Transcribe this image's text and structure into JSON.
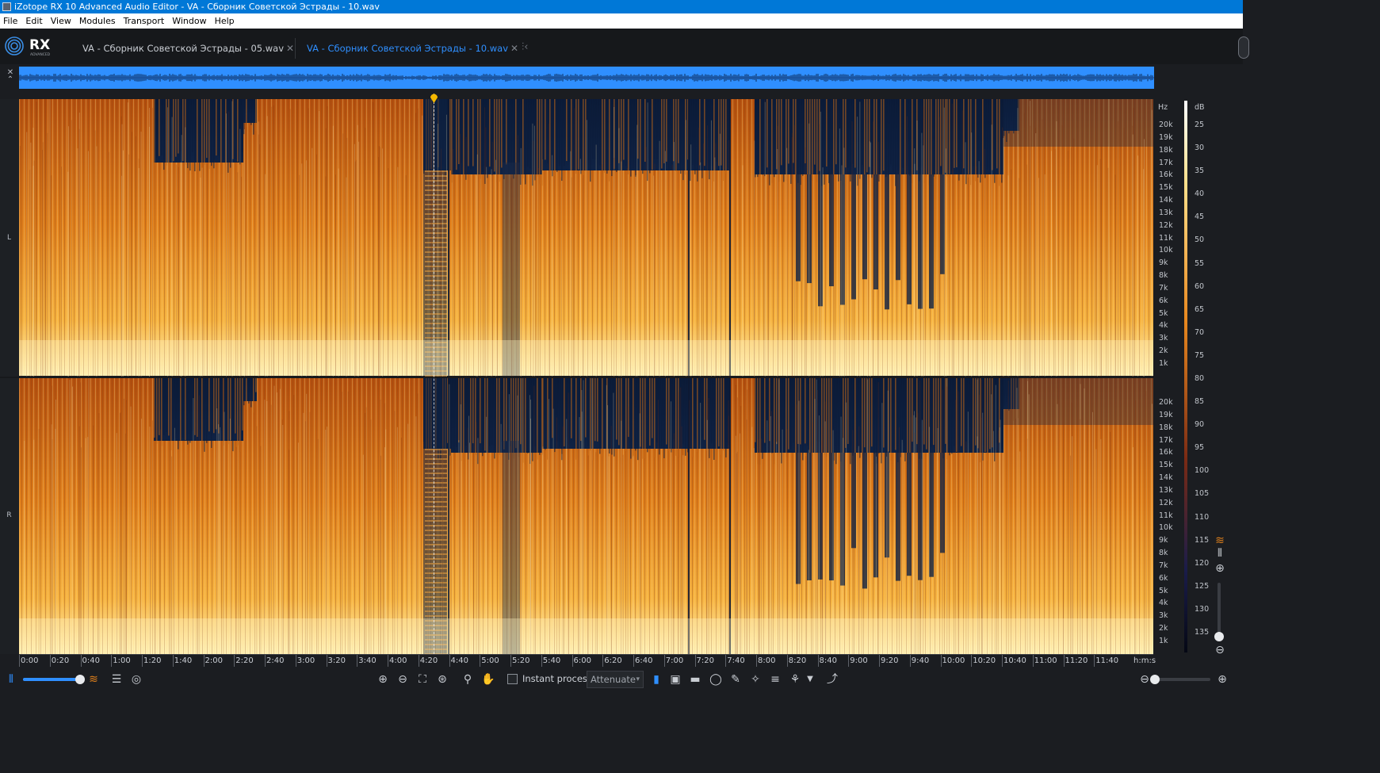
{
  "window": {
    "title": "iZotope RX 10 Advanced Audio Editor - VA - Сборник Советской Эстрады - 10.wav"
  },
  "menu": {
    "items": [
      "File",
      "Edit",
      "View",
      "Modules",
      "Transport",
      "Window",
      "Help"
    ]
  },
  "logo": {
    "text": "RX",
    "sub": "ADVANCED"
  },
  "tabs": [
    {
      "label": "VA - Сборник Советской Эстрады - 05.wav",
      "active": false
    },
    {
      "label": "VA - Сборник Советской Эстрады - 10.wav",
      "active": true
    }
  ],
  "channels": {
    "left": "L",
    "right": "R"
  },
  "frequency_axis": {
    "unit": "Hz",
    "labels": [
      "20k",
      "19k",
      "18k",
      "17k",
      "16k",
      "15k",
      "14k",
      "13k",
      "12k",
      "11k",
      "10k",
      "9k",
      "8k",
      "7k",
      "6k",
      "5k",
      "4k",
      "3k",
      "2k",
      "1k"
    ]
  },
  "db_axis": {
    "unit": "dB",
    "labels": [
      "25",
      "30",
      "35",
      "40",
      "45",
      "50",
      "55",
      "60",
      "65",
      "70",
      "75",
      "80",
      "85",
      "90",
      "95",
      "100",
      "105",
      "110",
      "115",
      "120",
      "125",
      "130",
      "135"
    ]
  },
  "timeline": {
    "labels": [
      "0:00",
      "0:20",
      "0:40",
      "1:00",
      "1:20",
      "1:40",
      "2:00",
      "2:20",
      "2:40",
      "3:00",
      "3:20",
      "3:40",
      "4:00",
      "4:20",
      "4:40",
      "5:00",
      "5:20",
      "5:40",
      "6:00",
      "6:20",
      "6:40",
      "7:00",
      "7:20",
      "7:40",
      "8:00",
      "8:20",
      "8:40",
      "9:00",
      "9:20",
      "9:40",
      "10:00",
      "10:20",
      "10:40",
      "11:00",
      "11:20",
      "11:40"
    ],
    "unit": "h:m:s"
  },
  "toolbar": {
    "instant_process_label": "Instant process",
    "instant_process_checked": false,
    "mode_select_value": "Attenuate"
  },
  "playhead_time": "4:30",
  "colors": {
    "accent": "#2f8fff",
    "titlebar": "#0078d7",
    "spectrogram_low": "#0a1a3a",
    "spectrogram_mid": "#d2691e",
    "spectrogram_high": "#ffe9a8",
    "playhead_marker": "#f5b800"
  }
}
